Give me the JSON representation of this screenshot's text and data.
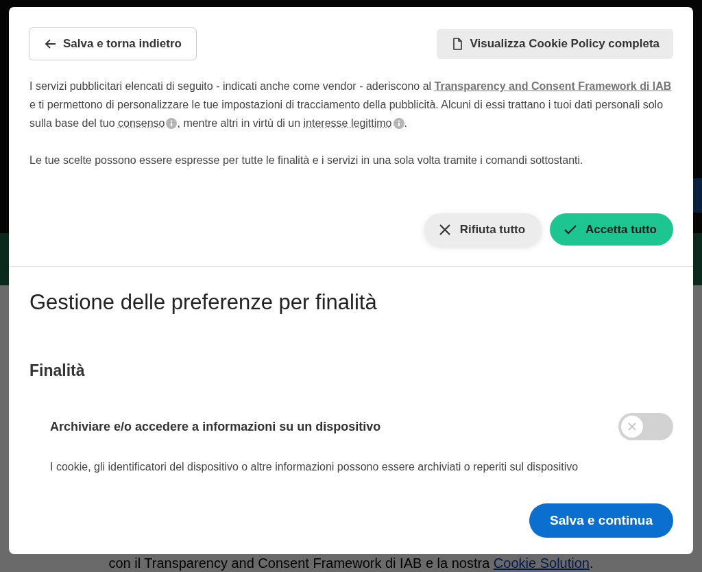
{
  "background": {
    "footer": [
      {
        "kind": "text",
        "text": "con il Transparency and Consent Framework di IAB e la nostra "
      },
      {
        "kind": "link",
        "text": "Cookie Solution"
      },
      {
        "kind": "text",
        "text": "."
      }
    ]
  },
  "header": {
    "back_button": "Salva e torna indietro",
    "policy_button": "Visualizza Cookie Policy completa"
  },
  "intro": [
    [
      {
        "kind": "text",
        "text": "I servizi pubblicitari elencati di seguito - indicati anche come vendor - aderiscono al "
      },
      {
        "kind": "link",
        "text": "Transparency and Consent Framework di IAB"
      },
      {
        "kind": "text",
        "text": " e ti permettono di personalizzare le tue impostazioni di tracciamento della pubblicità. Alcuni di essi trattano i tuoi dati personali solo sulla base del tuo "
      },
      {
        "kind": "term",
        "text": "consenso"
      },
      {
        "kind": "text",
        "text": ", mentre altri in virtù di un "
      },
      {
        "kind": "term",
        "text": "interesse legittimo"
      },
      {
        "kind": "text",
        "text": "."
      }
    ],
    [
      {
        "kind": "text",
        "text": "Le tue scelte possono essere espresse per tutte le finalità e i servizi in una sola volta tramite i comandi sottostanti."
      }
    ]
  ],
  "actions": [
    {
      "kind": "reject",
      "label": "Rifiuta tutto"
    },
    {
      "kind": "accept",
      "label": "Accetta tutto"
    }
  ],
  "section_title": "Gestione delle preferenze per finalità",
  "group_title": "Finalità",
  "purposes": [
    {
      "title": "Archiviare e/o accedere a informazioni su un dispositivo",
      "on": false,
      "description": "I cookie, gli identificatori del dispositivo o altre informazioni possono essere archiviati o reperiti sul dispositivo"
    }
  ],
  "save_button": "Salva e continua"
}
